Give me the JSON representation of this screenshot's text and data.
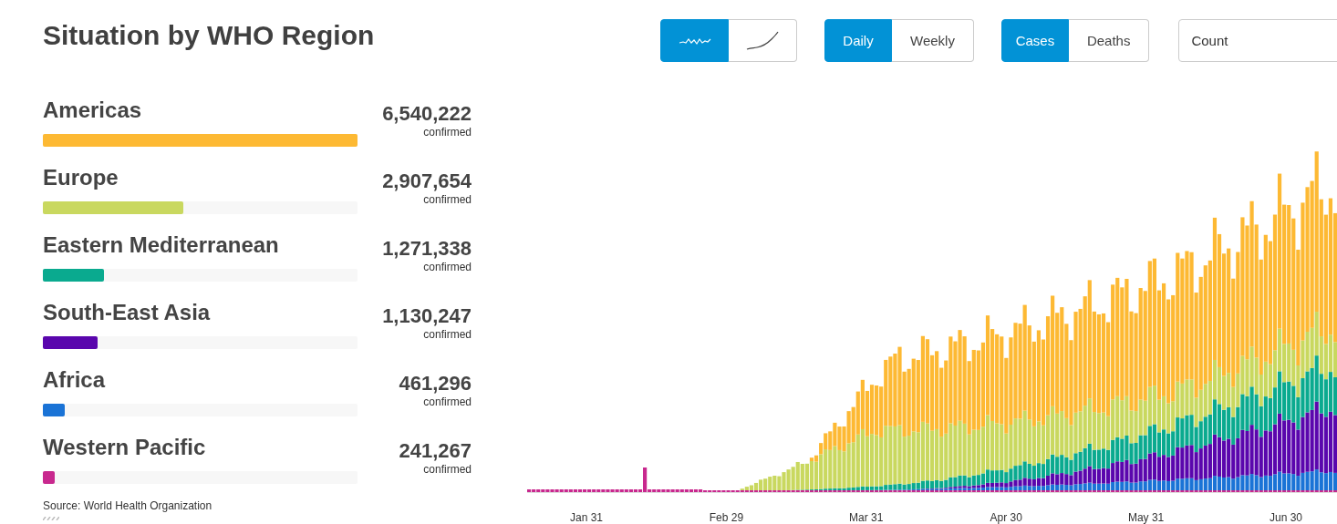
{
  "title": "Situation by WHO Region",
  "view_toggle": [
    {
      "kind": "wave",
      "selected": true
    },
    {
      "kind": "curve",
      "selected": false
    }
  ],
  "interval_toggle": [
    {
      "label": "Daily",
      "selected": true
    },
    {
      "label": "Weekly",
      "selected": false
    }
  ],
  "measure_toggle": [
    {
      "label": "Cases",
      "selected": true
    },
    {
      "label": "Deaths",
      "selected": false
    }
  ],
  "scale_select": {
    "value": "Count"
  },
  "regions": [
    {
      "name": "Americas",
      "level": 1,
      "color": "#fdb933",
      "count": "6,540,222",
      "unit": "confirmed"
    },
    {
      "name": "Europe",
      "level": 0.445,
      "color": "#c9d85f",
      "count": "2,907,654",
      "unit": "confirmed"
    },
    {
      "name": "Eastern Mediterranean",
      "level": 0.194,
      "color": "#0aaa8f",
      "count": "1,271,338",
      "unit": "confirmed"
    },
    {
      "name": "South-East Asia",
      "level": 0.173,
      "color": "#5a06ad",
      "count": "1,130,247",
      "unit": "confirmed"
    },
    {
      "name": "Africa",
      "level": 0.071,
      "color": "#1a73d6",
      "count": "461,296",
      "unit": "confirmed"
    },
    {
      "name": "Western Pacific",
      "level": 0.037,
      "color": "#c8288e",
      "count": "241,267",
      "unit": "confirmed"
    }
  ],
  "source": "Source:  World Health Organization",
  "chart": {
    "x_labels": [
      "Jan 31",
      "Feb 29",
      "Mar 31",
      "Apr 30",
      "May 31",
      "Jun 30"
    ]
  }
}
